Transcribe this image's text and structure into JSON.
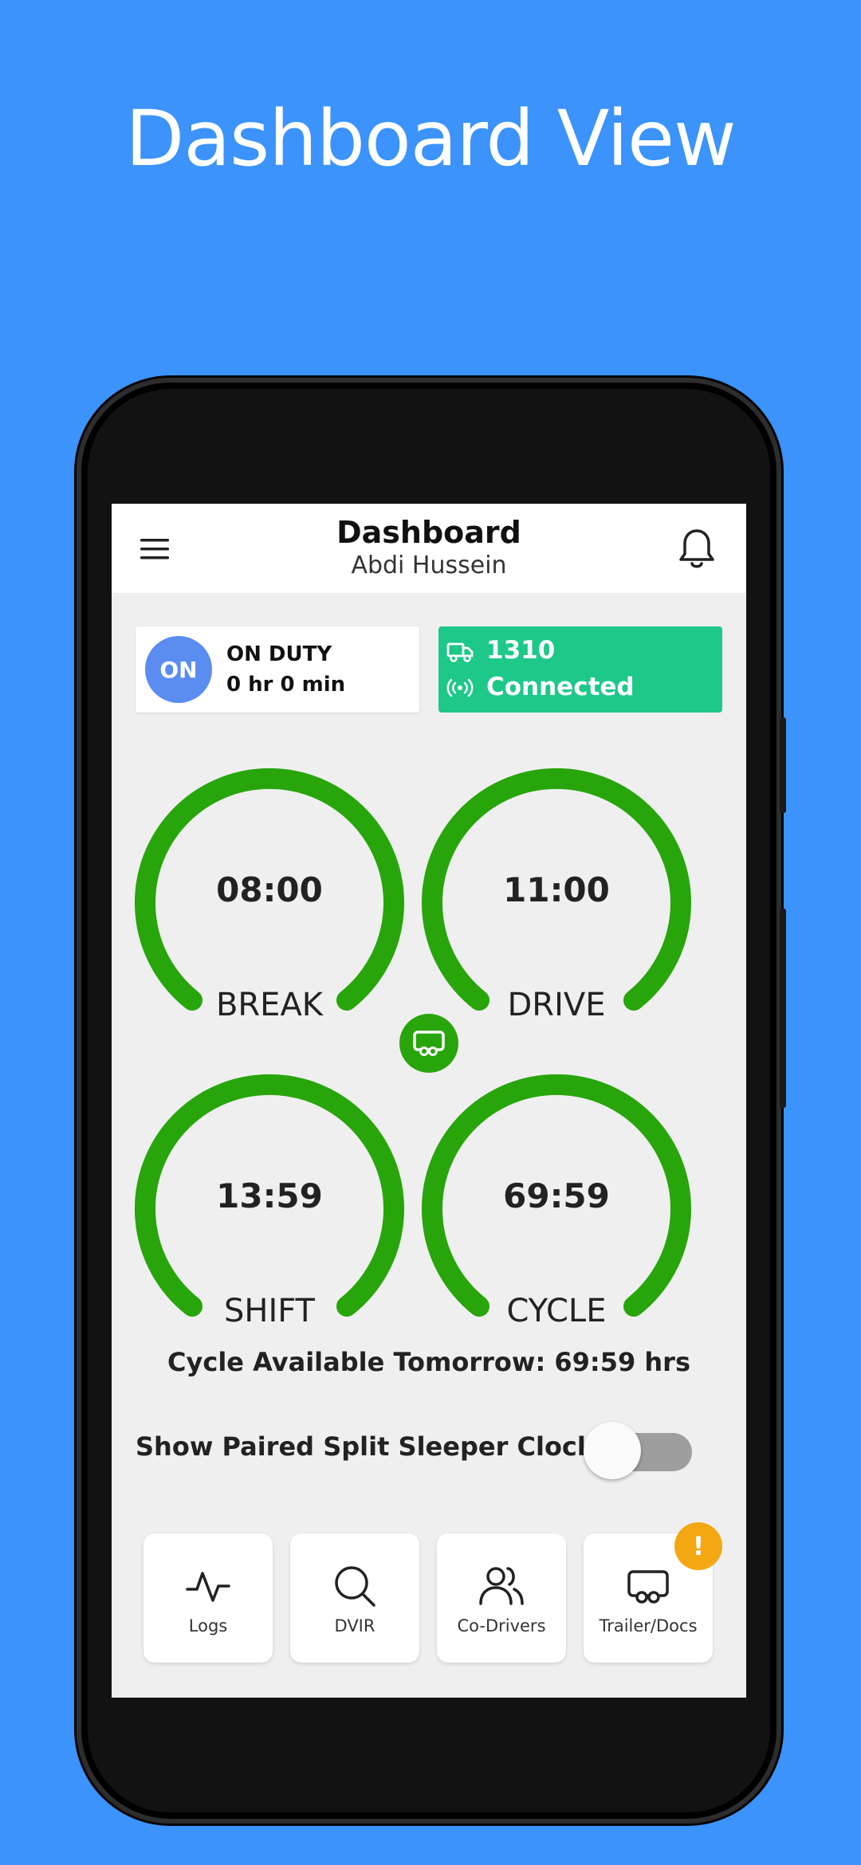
{
  "headline": "Dashboard View",
  "appbar": {
    "title": "Dashboard",
    "subtitle": "Abdi Hussein",
    "menu_icon": "hamburger-menu-icon",
    "bell_icon": "bell-icon"
  },
  "duty": {
    "badge": "ON",
    "status": "ON DUTY",
    "time": "0 hr 0 min",
    "badge_color": "#5B8DF0"
  },
  "connection": {
    "truck_number": "1310",
    "status": "Connected",
    "color": "#1DC889"
  },
  "gauges": [
    {
      "label": "BREAK",
      "value": "08:00"
    },
    {
      "label": "DRIVE",
      "value": "11:00"
    },
    {
      "label": "SHIFT",
      "value": "13:59"
    },
    {
      "label": "CYCLE",
      "value": "69:59"
    }
  ],
  "gauge_color": "#27A50B",
  "cycle_tomorrow": "Cycle Available Tomorrow: 69:59 hrs",
  "split_sleeper": {
    "label": "Show Paired Split Sleeper Clocks",
    "enabled": false
  },
  "nav": [
    {
      "label": "Logs",
      "icon": "activity-icon"
    },
    {
      "label": "DVIR",
      "icon": "search-icon"
    },
    {
      "label": "Co-Drivers",
      "icon": "users-icon"
    },
    {
      "label": "Trailer/Docs",
      "icon": "trailer-icon"
    }
  ],
  "alert_badge": "!"
}
